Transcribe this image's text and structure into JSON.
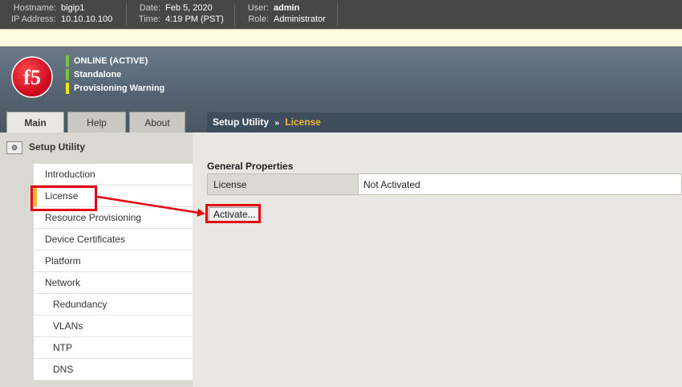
{
  "topbar": {
    "hostname_label": "Hostname:",
    "hostname": "bigip1",
    "ip_label": "IP Address:",
    "ip": "10.10.10.100",
    "date_label": "Date:",
    "date": "Feb 5, 2020",
    "time_label": "Time:",
    "time": "4:19 PM (PST)",
    "user_label": "User:",
    "user": "admin",
    "role_label": "Role:",
    "role": "Administrator"
  },
  "header": {
    "logo_text": "f5",
    "statuses": [
      {
        "label": "ONLINE (ACTIVE)",
        "color": "#7cc24a"
      },
      {
        "label": "Standalone",
        "color": "#7cc24a"
      },
      {
        "label": "Provisioning Warning",
        "color": "#f2e600"
      }
    ]
  },
  "tabs": [
    {
      "label": "Main",
      "active": true
    },
    {
      "label": "Help",
      "active": false
    },
    {
      "label": "About",
      "active": false
    }
  ],
  "breadcrumb": {
    "section": "Setup Utility",
    "separator": "»",
    "current": "License"
  },
  "sidebar": {
    "title": "Setup Utility",
    "items": [
      {
        "label": "Introduction"
      },
      {
        "label": "License"
      },
      {
        "label": "Resource Provisioning"
      },
      {
        "label": "Device Certificates"
      },
      {
        "label": "Platform"
      },
      {
        "label": "Network"
      },
      {
        "label": "Redundancy"
      },
      {
        "label": "VLANs"
      },
      {
        "label": "NTP"
      },
      {
        "label": "DNS"
      }
    ]
  },
  "content": {
    "section_title": "General Properties",
    "properties": [
      {
        "key": "License",
        "value": "Not Activated"
      }
    ],
    "activate_button": "Activate..."
  },
  "colors": {
    "accent": "#f2b829",
    "annotation": "#e3000f",
    "header_dark": "#3e4d5c"
  }
}
